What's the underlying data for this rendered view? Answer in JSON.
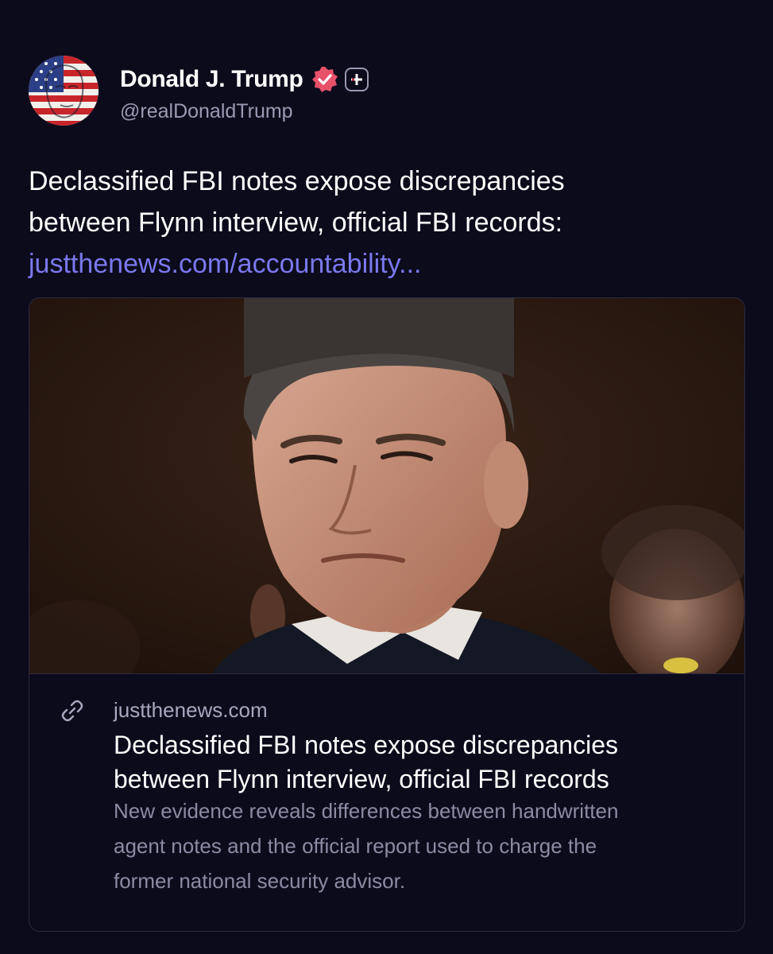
{
  "author": {
    "display_name": "Donald J. Trump",
    "handle": "@realDonaldTrump",
    "avatar_icon": "flag-face-avatar",
    "verified_icon": "verified-badge-icon",
    "verified_color": "#e8516a",
    "plus_icon": "plus-badge-icon"
  },
  "post": {
    "text_lines": [
      "Declassified FBI notes expose discrepancies",
      "between Flynn interview, official FBI records:"
    ],
    "link_text": "justthenews.com/accountability...",
    "link_color": "#7b78ee"
  },
  "card": {
    "image_icon": "article-photo",
    "link_icon": "link-chain-icon",
    "domain": "justthenews.com",
    "title_lines": [
      "Declassified FBI notes expose discrepancies",
      "between Flynn interview, official FBI records"
    ],
    "description_lines": [
      "New evidence reveals differences between handwritten",
      "agent notes and the official report used to charge the",
      "former national security advisor."
    ]
  },
  "colors": {
    "background": "#0c0b1c",
    "border": "#2b2a40",
    "muted_text": "#8d8ba4"
  }
}
